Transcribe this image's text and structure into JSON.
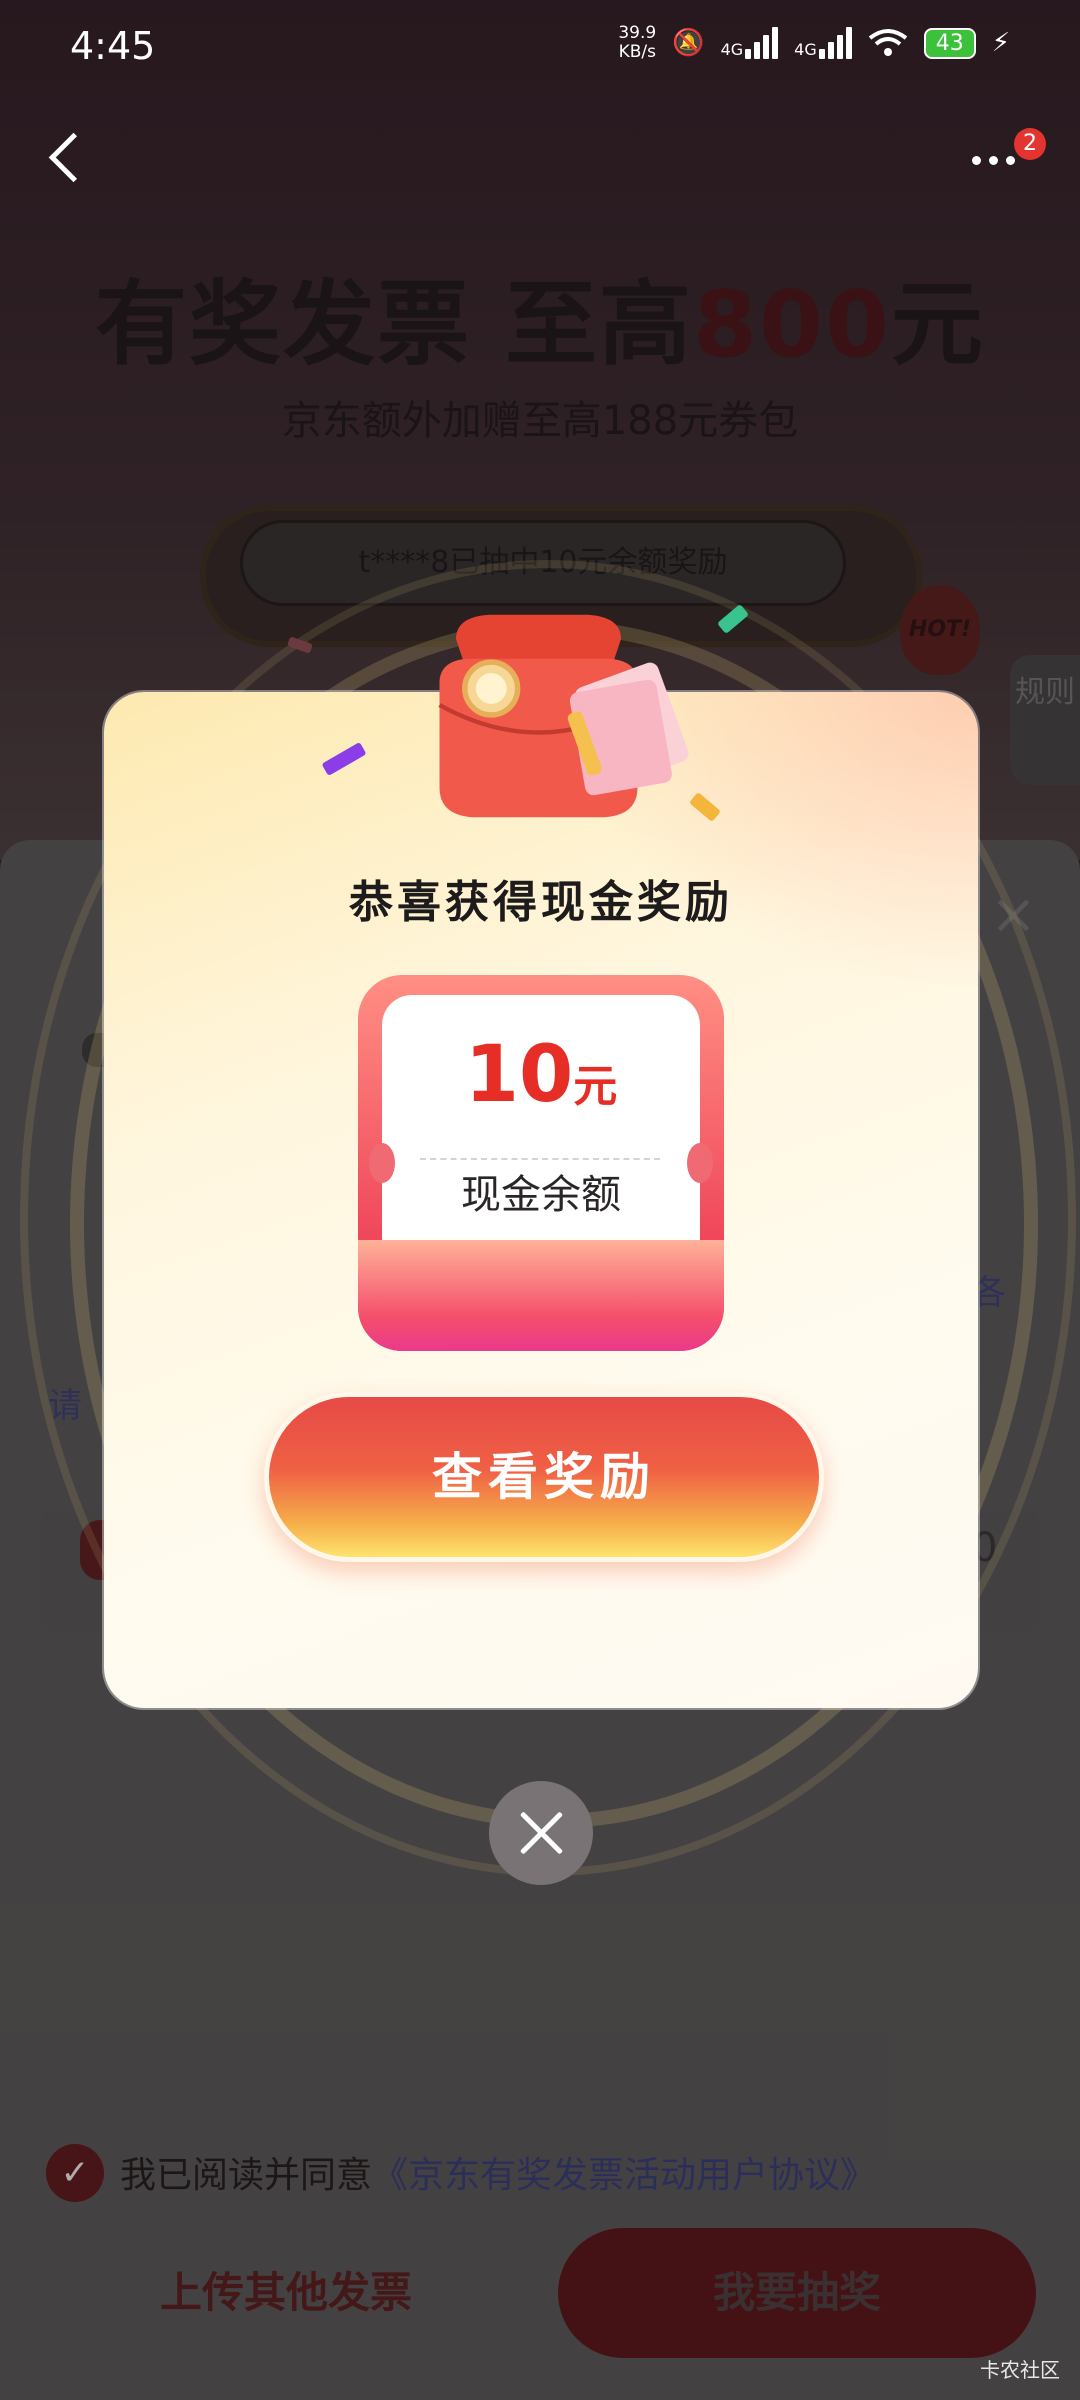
{
  "status_bar": {
    "time": "4:45",
    "speed": "39.9",
    "speed_unit": "KB/s",
    "net1": "4G",
    "net2": "4G",
    "battery": "43"
  },
  "nav": {
    "badge_count": "2"
  },
  "background_page": {
    "headline_prefix": "有奖发票 至高",
    "headline_amount": "800",
    "headline_suffix": "元",
    "subhead": "京东额外加赠至高188元券包",
    "ticker": "t****8已抽中10元余额奖励",
    "hot_label": "HOT!",
    "rule_tab": "规则",
    "partial_left": "请",
    "partial_right": "各",
    "partial_right_value": "0"
  },
  "agreement": {
    "text": "我已阅读并同意",
    "link": "《京东有奖发票活动用户协议》"
  },
  "bottom_buttons": {
    "upload": "上传其他发票",
    "draw": "我要抽奖"
  },
  "modal": {
    "title": "恭喜获得现金奖励",
    "amount": "10",
    "unit": "元",
    "reward_type": "现金余额",
    "cta": "查看奖励"
  },
  "watermark": "卡农社区",
  "colors": {
    "accent_red": "#e62e26",
    "modal_bg": "#fff6de",
    "link_blue": "#353c7e"
  }
}
